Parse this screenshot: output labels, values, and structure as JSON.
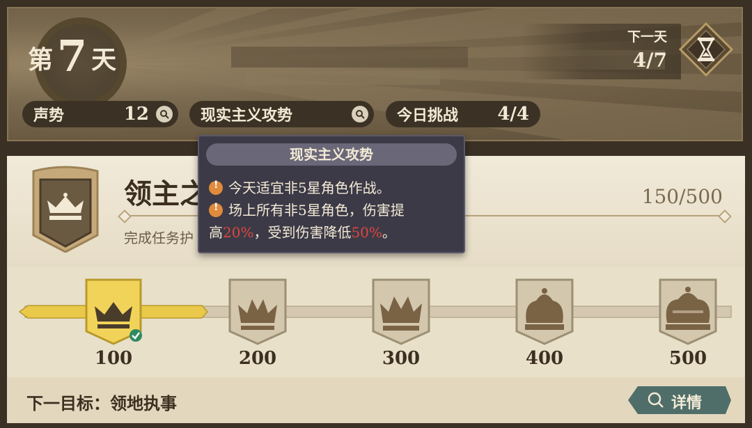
{
  "header": {
    "day_prefix": "第",
    "day_number": "7",
    "day_suffix": "天",
    "next_day_label": "下一天",
    "next_day_progress": "4/7"
  },
  "stats": [
    {
      "label": "声势",
      "value": "12"
    },
    {
      "label": "现实主义攻势",
      "value": ""
    },
    {
      "label": "今日挑战",
      "value": "4/4"
    }
  ],
  "tooltip": {
    "title": "现实主义攻势",
    "line1": "今天适宜非5星角色作战。",
    "line2": "场上所有非5星角色，伤害提",
    "line3_a": "高",
    "line3_b": "20%",
    "line3_c": "，受到伤害降低",
    "line3_d": "50%",
    "line3_e": "。"
  },
  "rank": {
    "title_visible": "领主之",
    "subtitle_visible": "完成任务护",
    "progress": "150/500"
  },
  "milestones": [
    {
      "value": "100",
      "achieved": true
    },
    {
      "value": "200",
      "achieved": false
    },
    {
      "value": "300",
      "achieved": false
    },
    {
      "value": "400",
      "achieved": false
    },
    {
      "value": "500",
      "achieved": false
    }
  ],
  "footer": {
    "next_target": "下一目标：领地执事",
    "details_label": "详情"
  },
  "colors": {
    "gold": "#e9c84a",
    "highlight_red": "#e0473e",
    "dark_brown": "#3b3124"
  },
  "icons": [
    "search-icon",
    "hourglass-icon",
    "crown-icon",
    "check-icon",
    "info-icon"
  ]
}
